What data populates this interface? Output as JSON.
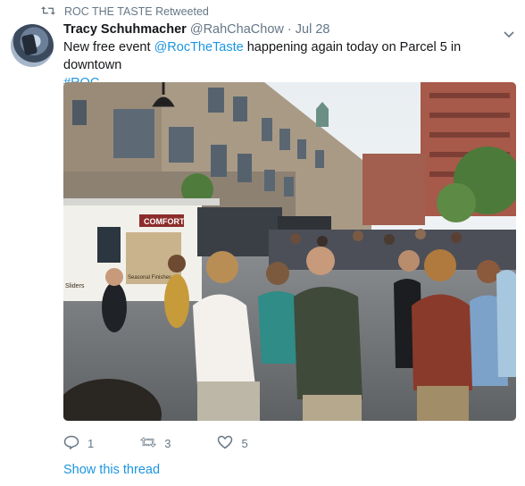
{
  "retweet": {
    "label": "ROC THE TASTE Retweeted",
    "icon": "retweet-icon"
  },
  "tweet": {
    "author_name": "Tracy Schuhmacher",
    "handle": "@RahChaChow",
    "separator": "·",
    "date": "Jul 28",
    "text_before": "New free event ",
    "mention": "@RocTheTaste",
    "text_middle": " happening again today on Parcel 5 in downtown ",
    "hashtag": "#ROC",
    "text_after": "."
  },
  "photo": {
    "truck_sign": "COMFORT",
    "panel_text": "Seasonal Finishes",
    "side_text": "Sliders"
  },
  "actions": {
    "reply_count": "1",
    "retweet_count": "3",
    "like_count": "5"
  },
  "thread_link": "Show this thread",
  "colors": {
    "link": "#1b95e0",
    "secondary_text": "#657786",
    "primary_text": "#14171a"
  }
}
